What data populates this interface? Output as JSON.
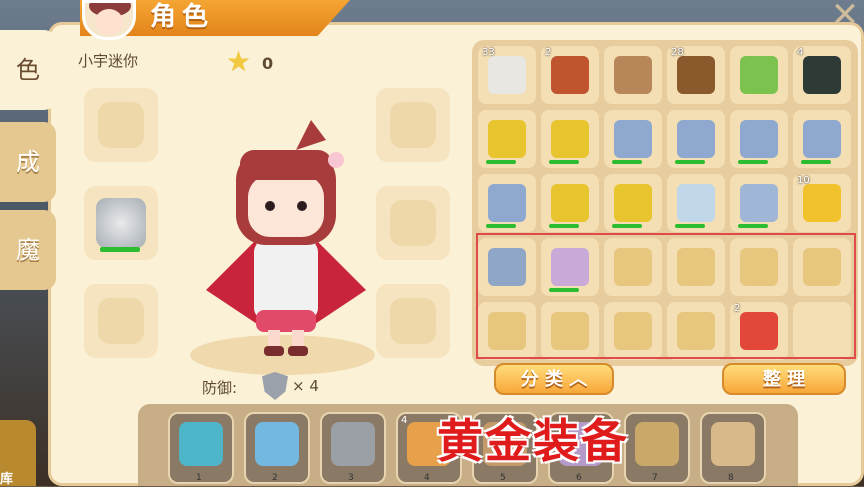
{
  "header": {
    "title": "角色",
    "close_glyph": "✕"
  },
  "side_tabs": [
    {
      "label": "色",
      "active": true
    },
    {
      "label": "成",
      "active": false
    },
    {
      "label": "魔",
      "active": false
    }
  ],
  "player": {
    "name": "小宇迷你",
    "stars": "0"
  },
  "equip_slots": [
    {
      "name": "helmet-slot",
      "icon": "helmet-placeholder-icon",
      "filled": false
    },
    {
      "name": "chest-slot",
      "icon": "chainmail-chestplate-icon",
      "filled": true
    },
    {
      "name": "leggings-slot",
      "icon": "leggings-placeholder-icon",
      "filled": false
    },
    {
      "name": "gloves-slot",
      "icon": "gloves-placeholder-icon",
      "filled": false
    },
    {
      "name": "cape-slot",
      "icon": "cape-placeholder-icon",
      "filled": false
    },
    {
      "name": "boots-slot",
      "icon": "boots-placeholder-icon",
      "filled": false
    }
  ],
  "defense": {
    "label": "防御:",
    "value": "× 4"
  },
  "inventory": {
    "rows": [
      [
        {
          "icon": "white-block-icon",
          "count": "33",
          "color": "#e9e7e2"
        },
        {
          "icon": "brick-block-icon",
          "count": "2",
          "color": "#c0542e"
        },
        {
          "icon": "wooden-post-icon",
          "count": "",
          "color": "#b7875a"
        },
        {
          "icon": "torch-icon",
          "count": "28",
          "color": "#8a5a2c"
        },
        {
          "icon": "bed-icon",
          "count": "",
          "color": "#7bc24f"
        },
        {
          "icon": "dark-block-icon",
          "count": "4",
          "color": "#2e3a36"
        }
      ],
      [
        {
          "icon": "gold-axe-icon",
          "count": "",
          "color": "#e8c52f",
          "bar": true
        },
        {
          "icon": "gold-axe-icon",
          "count": "",
          "color": "#e8c52f",
          "bar": true
        },
        {
          "icon": "iron-pickaxe-icon",
          "count": "",
          "color": "#8ea8d0",
          "bar": true
        },
        {
          "icon": "iron-pickaxe-icon",
          "count": "",
          "color": "#8ea8d0",
          "bar": true
        },
        {
          "icon": "iron-pickaxe-icon",
          "count": "",
          "color": "#8ea8d0",
          "bar": true
        },
        {
          "icon": "iron-pickaxe-icon",
          "count": "",
          "color": "#8ea8d0",
          "bar": true
        }
      ],
      [
        {
          "icon": "iron-pickaxe-icon",
          "count": "",
          "color": "#8ea8d0",
          "bar": true
        },
        {
          "icon": "gold-pickaxe-icon",
          "count": "",
          "color": "#e8c52f",
          "bar": true
        },
        {
          "icon": "gold-pickaxe-icon",
          "count": "",
          "color": "#e8c52f",
          "bar": true
        },
        {
          "icon": "drill-icon",
          "count": "",
          "color": "#bfd7e8",
          "bar": true
        },
        {
          "icon": "shovel-icon",
          "count": "",
          "color": "#9fb6d6",
          "bar": true
        },
        {
          "icon": "gold-ingot-icon",
          "count": "10",
          "color": "#f1c22b"
        }
      ],
      [
        {
          "icon": "silver-ingot-icon",
          "count": "",
          "color": "#8fa6c7"
        },
        {
          "icon": "bow-icon",
          "count": "",
          "color": "#c8a9d8",
          "bar": true
        },
        {
          "icon": "gold-chestplate-icon",
          "count": "",
          "color": "#e7c77e"
        },
        {
          "icon": "gold-chestplate-icon",
          "count": "",
          "color": "#e7c77e"
        },
        {
          "icon": "gold-leggings-icon",
          "count": "",
          "color": "#e7c77e"
        },
        {
          "icon": "gold-leggings-icon",
          "count": "",
          "color": "#e7c77e"
        }
      ],
      [
        {
          "icon": "gold-leggings-icon",
          "count": "",
          "color": "#e7c77e"
        },
        {
          "icon": "gold-boots-icon",
          "count": "",
          "color": "#e7c77e"
        },
        {
          "icon": "gold-boots-icon",
          "count": "",
          "color": "#e7c77e"
        },
        {
          "icon": "gold-boots-icon",
          "count": "",
          "color": "#e7c77e"
        },
        {
          "icon": "watermelon-icon",
          "count": "2",
          "color": "#e2473a"
        },
        {
          "icon": "empty-slot",
          "count": "",
          "color": ""
        }
      ]
    ],
    "sort_label": "分 类 ︿",
    "arrange_label": "整 理"
  },
  "hotbar": [
    {
      "icon": "crystal-sword-icon",
      "count": "",
      "num": "1",
      "color": "#4fb6c9"
    },
    {
      "icon": "water-bucket-icon",
      "count": "",
      "num": "2",
      "color": "#73b8e0"
    },
    {
      "icon": "furnace-icon",
      "count": "",
      "num": "3",
      "color": "#9aa0a6"
    },
    {
      "icon": "bread-icon",
      "count": "4",
      "num": "4",
      "color": "#e6a14a"
    },
    {
      "icon": "item-slot-5-icon",
      "count": "",
      "num": "5",
      "color": "#c59a6a"
    },
    {
      "icon": "item-slot-6-icon",
      "count": "",
      "num": "6",
      "color": "#b49ac8"
    },
    {
      "icon": "item-slot-7-icon",
      "count": "",
      "num": "7",
      "color": "#c9a86a"
    },
    {
      "icon": "gold-armor-icon",
      "count": "",
      "num": "8",
      "color": "#d8b98a"
    }
  ],
  "overlay_caption": "黄金装备",
  "corner_label": "库"
}
